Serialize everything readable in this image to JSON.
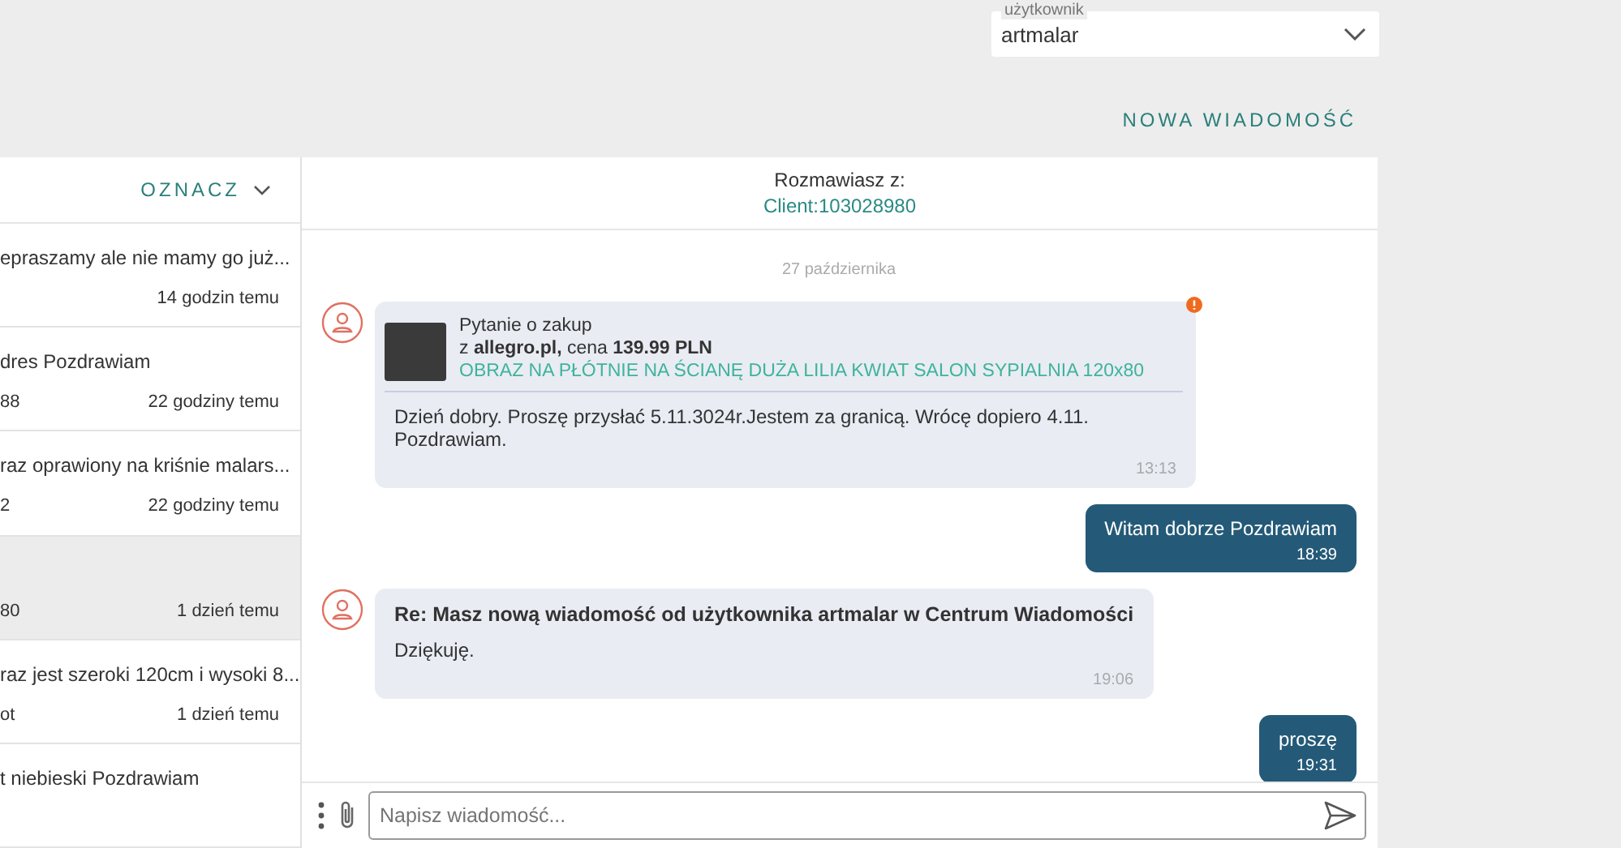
{
  "user_select": {
    "label": "użytkownik",
    "value": "artmalar"
  },
  "new_message_button": "NOWA WIADOMOŚĆ",
  "conversation_list": {
    "mark_button": "OZNACZ",
    "items": [
      {
        "preview": "epraszamy ale nie mamy go już...",
        "time": "14 godzin temu",
        "selected": false
      },
      {
        "preview": "dres Pozdrawiam",
        "sender": "88",
        "time": "22 godziny temu",
        "selected": false
      },
      {
        "preview": "raz oprawiony na kriśnie malars...",
        "sender": "2",
        "time": "22 godziny temu",
        "selected": false
      },
      {
        "sender": "80",
        "time": "1 dzień temu",
        "selected": true
      },
      {
        "preview": "raz jest szeroki 120cm i wysoki 8...",
        "sender": "ot",
        "time": "1 dzień temu",
        "selected": false
      },
      {
        "preview": "t niebieski Pozdrawiam",
        "selected": false
      }
    ]
  },
  "chat": {
    "header_label": "Rozmawiasz z:",
    "contact": "Client:103028980",
    "date_separator": "27 października",
    "messages": [
      {
        "kind": "inquiry",
        "title": "Pytanie o zakup",
        "source": "z **allegro.pl,** cena **139.99 PLN**",
        "product": "OBRAZ NA PŁÓTNIE NA ŚCIANĘ DUŻA LILIA KWIAT SALON SYPIALNIA 120x80",
        "body": "Dzień dobry. Proszę przysłać 5.11.3024r.Jestem za granicą. Wrócę dopiero 4.11. Pozdrawiam.",
        "time": "13:13",
        "alert": true
      },
      {
        "kind": "outgoing",
        "body": "Witam dobrze Pozdrawiam",
        "time": "18:39"
      },
      {
        "kind": "incoming",
        "subject": "Re: Masz nową wiadomość od użytkownika artmalar w Centrum Wiadomości",
        "body": "Dziękuję.",
        "time": "19:06"
      },
      {
        "kind": "outgoing",
        "body": "proszę",
        "time": "19:31"
      }
    ],
    "composer": {
      "placeholder": "Napisz wiadomość..."
    }
  }
}
